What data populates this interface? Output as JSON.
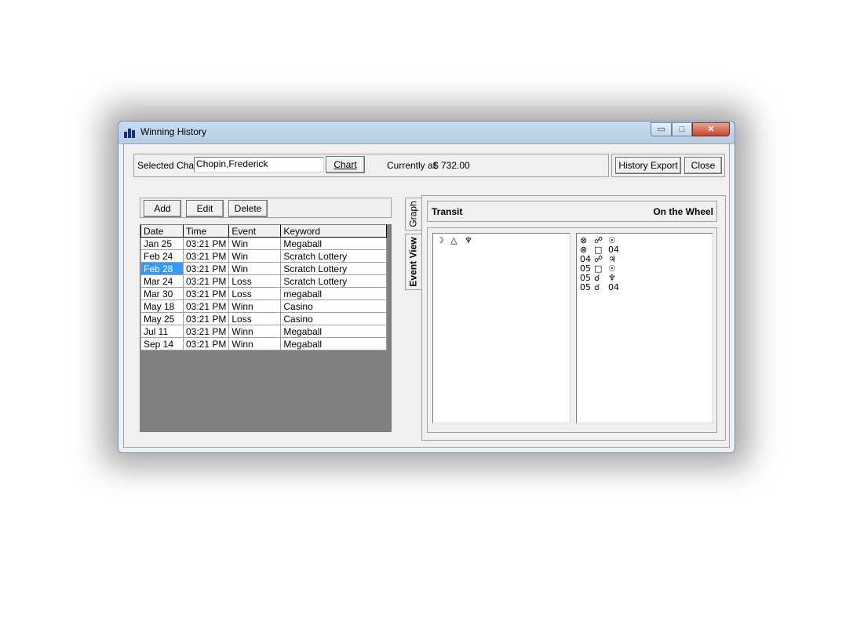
{
  "window": {
    "title": "Winning History",
    "min_glyph": "▭",
    "max_glyph": "□",
    "close_glyph": "✕"
  },
  "toolbar": {
    "selected_chart_label": "Selected Chart",
    "selected_chart_value": "Chopin,Frederick",
    "chart_button": "Chart",
    "currently_label": "Currently at",
    "currently_value": "$ 732.00",
    "history_export_button": "History Export",
    "close_button": "Close"
  },
  "actions": {
    "add": "Add",
    "edit": "Edit",
    "delete": "Delete"
  },
  "table": {
    "columns": [
      "Date",
      "Time",
      "Event",
      "Keyword"
    ],
    "rows": [
      [
        "Jan 25",
        "03:21 PM",
        "Win",
        "Megaball"
      ],
      [
        "Feb 24",
        "03:21 PM",
        "Win",
        "Scratch Lottery"
      ],
      [
        "Feb 28",
        "03:21 PM",
        "Win",
        "Scratch Lottery"
      ],
      [
        "Mar 24",
        "03:21 PM",
        "Loss",
        "Scratch Lottery"
      ],
      [
        "Mar 30",
        "03:21 PM",
        "Loss",
        "megaball"
      ],
      [
        "May 18",
        "03:21 PM",
        "Winn",
        "Casino"
      ],
      [
        "May 25",
        "03:21 PM",
        "Loss",
        "Casino"
      ],
      [
        "Jul 11",
        "03:21 PM",
        "Winn",
        "Megaball"
      ],
      [
        "Sep 14",
        "03:21 PM",
        "Winn",
        "Megaball"
      ]
    ],
    "selected_row": 2
  },
  "tabs": {
    "graph": "Graph",
    "event_view": "Event View",
    "active": "event_view"
  },
  "panel": {
    "transit_label": "Transit",
    "on_the_wheel_label": "On the Wheel",
    "transit_rows": [
      [
        "☽",
        "△",
        "♆"
      ]
    ],
    "wheel_rows": [
      [
        "⊗",
        "☍",
        "☉"
      ],
      [
        "⊗",
        "□",
        "04"
      ],
      [
        "04",
        "☍",
        "♃"
      ],
      [
        "05",
        "□",
        "☉"
      ],
      [
        "05",
        "☌",
        "♆"
      ],
      [
        "05",
        "☌",
        "04"
      ]
    ]
  }
}
